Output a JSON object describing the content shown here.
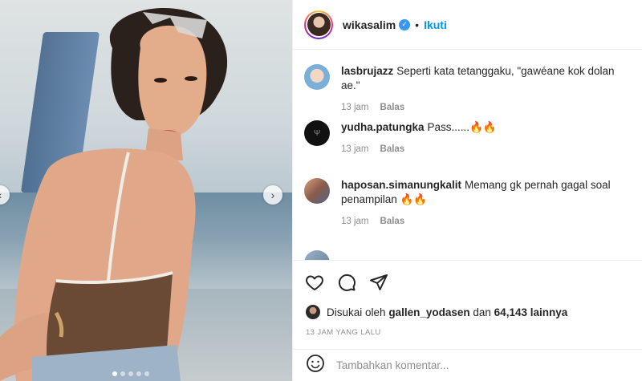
{
  "post": {
    "username": "wikasalim",
    "separator": "•",
    "follow_label": "Ikuti"
  },
  "comments": [
    {
      "user": "lasbrujazz",
      "text": "Seperti kata tetanggaku, \"gawéane kok dolan ae.\"",
      "time": "13 jam",
      "reply": "Balas"
    },
    {
      "user": "yudha.patungka",
      "text": "Pass......🔥🔥",
      "time": "13 jam",
      "reply": "Balas"
    },
    {
      "user": "haposan.simanungkalit",
      "text": "Memang gk pernah gagal soal penampilan 🔥🔥",
      "time": "13 jam",
      "reply": "Balas"
    }
  ],
  "likes": {
    "prefix": "Disukai oleh",
    "user": "gallen_yodasen",
    "middle": "dan",
    "count": "64,143 lainnya"
  },
  "timestamp": "13 JAM YANG LALU",
  "add_comment": {
    "placeholder": "Tambahkan komentar..."
  },
  "icons": {
    "like": "heart-icon",
    "comment": "comment-icon",
    "share": "send-icon",
    "emoji": "emoji-icon"
  },
  "colors": {
    "accent": "#0095f6",
    "verified": "#3897f0"
  }
}
